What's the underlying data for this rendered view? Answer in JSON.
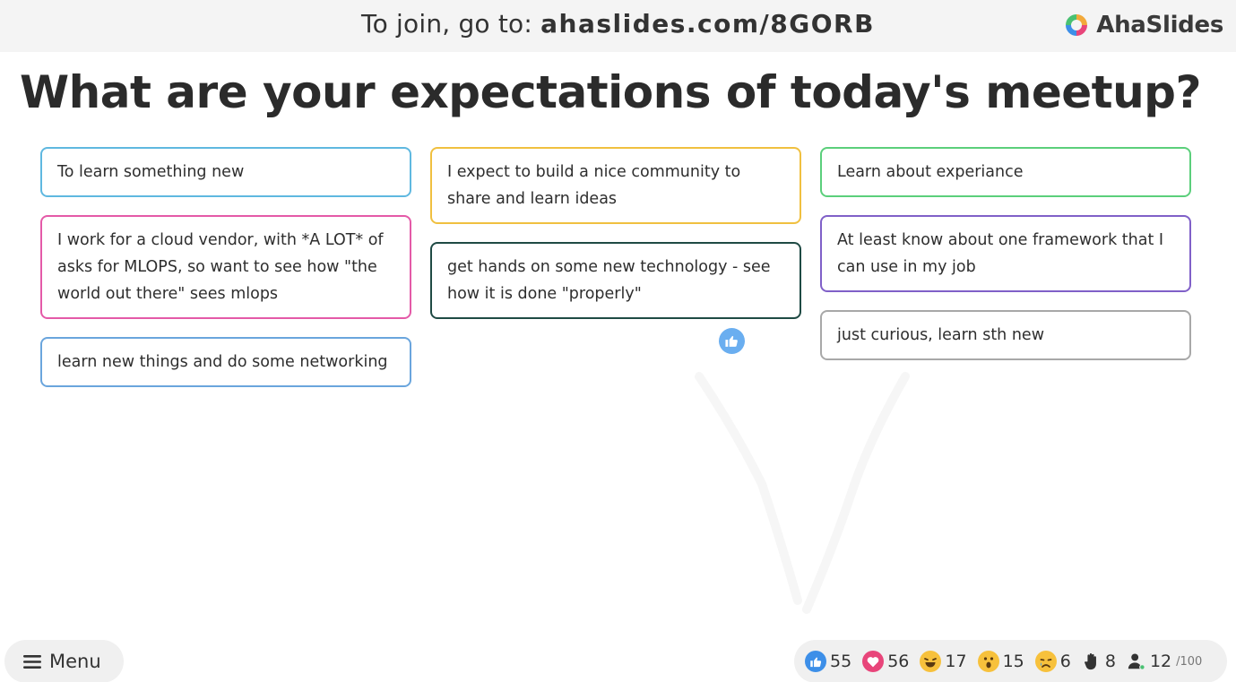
{
  "header": {
    "join_prefix": "To join, go to: ",
    "join_url": "ahaslides.com/8GORB",
    "logo_text": "AhaSlides"
  },
  "slide": {
    "title": "What are your expectations of today's meetup?"
  },
  "columns": [
    [
      {
        "text": "To learn something new",
        "color": "#5fb8e0"
      },
      {
        "text": "I work for a cloud vendor, with *A LOT* of asks for MLOPS, so want to see how \"the world out there\" sees mlops",
        "color": "#e45aa8"
      },
      {
        "text": "learn new things and do some networking",
        "color": "#6aa5dd"
      }
    ],
    [
      {
        "text": "I expect to build a nice community to share and learn ideas",
        "color": "#f0c040"
      },
      {
        "text": "get hands on some new technology - see how it is done \"properly\"",
        "color": "#1f4a44"
      }
    ],
    [
      {
        "text": "Learn about experiance",
        "color": "#5bcf7b"
      },
      {
        "text": "At least know about one framework that I can use in my job",
        "color": "#8060c8"
      },
      {
        "text": "just curious, learn sth new",
        "color": "#a8a8a8"
      }
    ]
  ],
  "footer": {
    "menu_label": "Menu",
    "reactions": {
      "like": "55",
      "heart": "56",
      "laugh": "17",
      "wow": "15",
      "sad": "6",
      "hand": "8",
      "participants": "12",
      "participants_max": "/100"
    }
  },
  "colors": {
    "like_blue": "#3d8fe8",
    "heart_pink": "#e8457a",
    "emoji_yellow": "#f7c13c"
  }
}
